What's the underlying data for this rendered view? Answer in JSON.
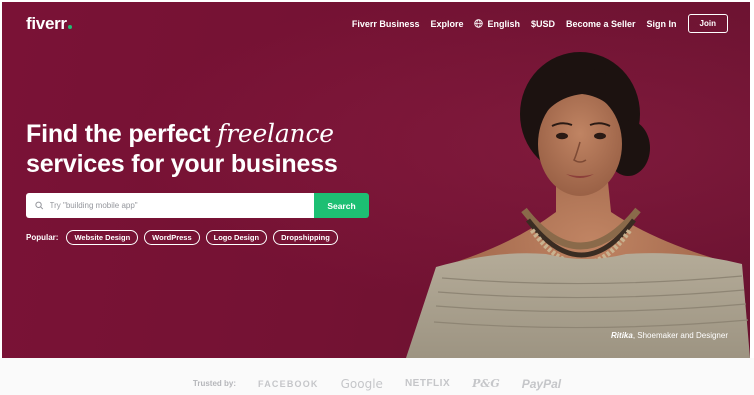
{
  "brand": {
    "logo_text": "fiverr",
    "accent": "#1dbf73",
    "hero_bg": "#741233"
  },
  "nav": {
    "items": [
      "Fiverr Business",
      "Explore",
      "English",
      "$USD",
      "Become a Seller",
      "Sign In"
    ],
    "language_icon": "globe-icon",
    "join_label": "Join"
  },
  "hero": {
    "headline_line1": "Find the perfect ",
    "headline_italic": "freelance",
    "headline_line2": "services for your business",
    "search": {
      "placeholder": "Try \"building mobile app\"",
      "icon": "search-icon",
      "button_label": "Search"
    },
    "popular_label": "Popular:",
    "popular_tags": [
      "Website Design",
      "WordPress",
      "Logo Design",
      "Dropshipping"
    ],
    "caption_name": "Ritika",
    "caption_role": ", Shoemaker and Designer"
  },
  "trusted": {
    "label": "Trusted by:",
    "brands": [
      "FACEBOOK",
      "Google",
      "NETFLIX",
      "P&G",
      "PayPal"
    ]
  }
}
